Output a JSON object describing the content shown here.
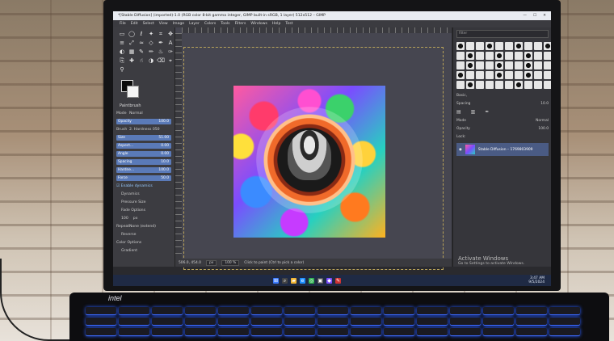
{
  "window": {
    "title": "*[Stable Diffusion] (imported)-1.0 (RGB color 8-bit gamma integer, GIMP built-in sRGB, 1 layer) 512x512 – GIMP",
    "controls": [
      "—",
      "☐",
      "✕"
    ]
  },
  "menu": [
    "File",
    "Edit",
    "Select",
    "View",
    "Image",
    "Layer",
    "Colors",
    "Tools",
    "Filters",
    "Windows",
    "Help",
    "Test"
  ],
  "tool_options": {
    "title": "Paintbrush",
    "mode_label": "Mode",
    "mode_value": "Normal",
    "opacity_label": "Opacity",
    "opacity_value": "100.0",
    "brush_label": "Brush",
    "brush_value": "2. Hardness 050",
    "size_label": "Size",
    "size_value": "51.00",
    "aspect_label": "Aspect...",
    "aspect_value": "0.00",
    "angle_label": "Angle",
    "angle_value": "0.00",
    "spacing_label": "Spacing",
    "spacing_value": "10.0",
    "hardness_label": "Hardne...",
    "hardness_value": "100.0",
    "force_label": "Force",
    "force_value": "50.0",
    "enable_dynamics": "Enable dynamics",
    "dynamics_label": "Dynamics",
    "dynamics_value": "Pressure Size",
    "fade_options": "Fade Options",
    "fade_len": "100",
    "fade_unit": "px",
    "repeat_label": "Repeat",
    "repeat_value": "None (extend)",
    "reverse": "Reverse",
    "color_options": "Color Options",
    "gradient": "Gradient"
  },
  "status": {
    "coords": "506.0, 454.0",
    "unit": "px",
    "zoom": "100 %",
    "message": "Click to paint (Ctrl to pick a color)"
  },
  "dock": {
    "filter_placeholder": "filter",
    "basic": "Basic,",
    "spacing_label": "Spacing",
    "spacing_value": "10.0",
    "mode_label": "Mode",
    "mode_value": "Normal",
    "opacity_label": "Opacity",
    "opacity_value": "100.0",
    "lock_label": "Lock:",
    "layer_name": "Stable Diffusion – 1769803909",
    "activate_title": "Activate Windows",
    "activate_sub": "Go to Settings to activate Windows."
  },
  "taskbar": {
    "time": "3:47 AM",
    "date": "9/5/2024",
    "lang": "ENG"
  },
  "brand": "intel",
  "colors": {
    "accent": "#5a7ab8",
    "layer_selected": "#4a5b84",
    "taskbar": "#1f2a44",
    "key_glow": "#2b5dff"
  },
  "icons": {
    "tools": [
      "rect-select-icon",
      "ellipse-select-icon",
      "lasso-icon",
      "fuzzy-select-icon",
      "crop-icon",
      "move-icon",
      "align-icon",
      "transform-icon",
      "warp-icon",
      "cage-icon",
      "paths-icon",
      "text-icon",
      "bucket-icon",
      "gradient-icon",
      "paintbrush-icon",
      "pencil-icon",
      "airbrush-icon",
      "ink-icon",
      "clone-icon",
      "heal-icon",
      "smudge-icon",
      "dodge-icon",
      "eraser-icon",
      "picker-icon",
      "zoom-icon"
    ]
  }
}
